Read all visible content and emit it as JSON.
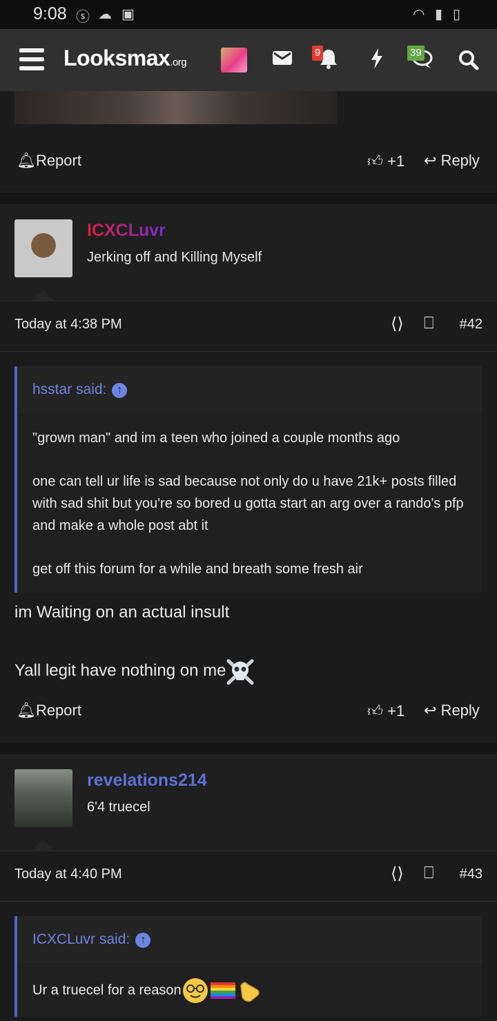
{
  "status_bar": {
    "time": "9:08"
  },
  "header": {
    "logo_main": "Looksmax",
    "logo_suffix": ".org",
    "alerts_badge": "9",
    "conversations_badge": "39",
    "badge_color": "#e03c31",
    "conversations_badge_color": "#62a843"
  },
  "actions": {
    "report": "Report",
    "like_count": "+1",
    "reply": "Reply"
  },
  "posts": [
    {
      "username": "ICXCLuvr",
      "user_title": "Jerking off and Killing Myself",
      "date": "Today at 4:38 PM",
      "number": "#42",
      "quote_author": "hsstar said:",
      "quote_paragraphs": [
        "\"grown man\" and im a teen who joined a couple months ago",
        "one can tell ur life is sad because not only do u have 21k+ posts filled with sad shit but you're so bored u gotta start an arg over a rando's pfp and make a whole post abt it",
        "get off this forum for a while and breath some fresh air"
      ],
      "message_lines": [
        "im Waiting on an actual insult",
        "Yall legit have nothing on me"
      ]
    },
    {
      "username": "revelations214",
      "user_title": "6'4 truecel",
      "date": "Today at 4:40 PM",
      "number": "#43",
      "quote_author": "ICXCLuvr said:",
      "quote_paragraphs": [
        "Ur a truecel for a reason"
      ]
    }
  ],
  "colors": {
    "username_gradient_start": "#d8213a",
    "username_gradient_end": "#7a2bd4",
    "username_blue": "#5b72d6",
    "quote_accent": "#5165c2"
  },
  "icons": [
    "hamburger-icon",
    "envelope-icon",
    "bell-icon",
    "bolt-icon",
    "conversations-icon",
    "search-icon",
    "thumbs-up-icon",
    "reply-icon",
    "share-icon",
    "bookmark-icon",
    "skull-emoji",
    "nerd-emoji",
    "rainbow-flag-emoji",
    "pointing-hand-emoji"
  ]
}
